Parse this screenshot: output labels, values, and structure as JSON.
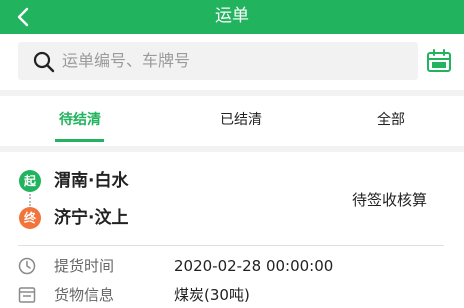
{
  "header": {
    "title": "运单",
    "back_icon": "chevron-left-icon"
  },
  "search": {
    "placeholder": "运单编号、车牌号",
    "icon": "search-icon",
    "calendar_icon": "calendar-icon"
  },
  "tabs": [
    {
      "label": "待结清",
      "active": true
    },
    {
      "label": "已结清",
      "active": false
    },
    {
      "label": "全部",
      "active": false
    }
  ],
  "waybill": {
    "origin_badge": "起",
    "origin": "渭南·白水",
    "destination_badge": "终",
    "destination": "济宁·汶上",
    "status": "待签收核算",
    "details": [
      {
        "icon": "clock-icon",
        "label": "提货时间",
        "value": "2020-02-28 00:00:00"
      },
      {
        "icon": "cargo-info-icon",
        "label": "货物信息",
        "value": "煤炭(30吨)"
      }
    ]
  },
  "colors": {
    "accent": "#22b35e",
    "destination": "#f2743b",
    "background": "#f2f2f2"
  }
}
